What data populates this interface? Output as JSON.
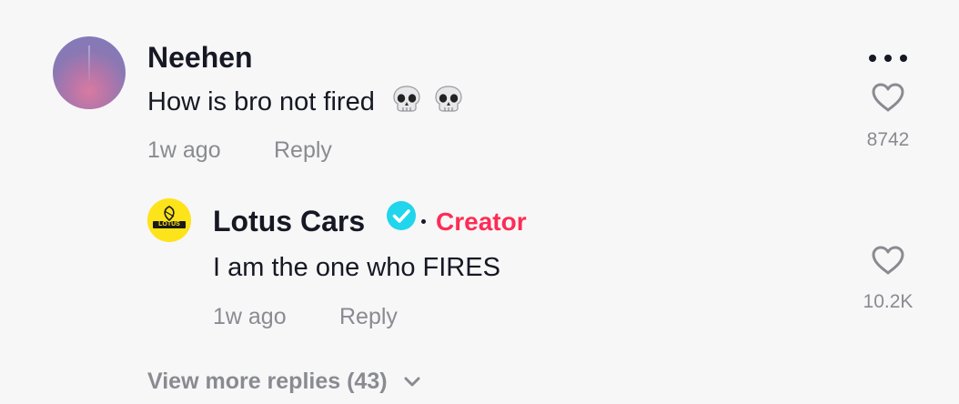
{
  "comment": {
    "username": "Neehen",
    "text": "How is bro not fired",
    "emoji": "skull-icon x2",
    "time": "1w ago",
    "reply_label": "Reply",
    "likes": "8742"
  },
  "reply": {
    "username": "Lotus Cars",
    "badge_separator": "·",
    "badge_label": "Creator",
    "avatar_text": "LOTUS",
    "text": "I am the one who FIRES",
    "time": "1w ago",
    "reply_label": "Reply",
    "likes": "10.2K"
  },
  "view_more": {
    "label": "View more replies (43)"
  },
  "colors": {
    "background": "#f7f7f8",
    "text": "#161823",
    "secondary": "#8a8b91",
    "creator": "#fe2c55",
    "verified": "#20d5ec",
    "lotus_yellow": "#fde31a"
  },
  "icons": [
    "more-icon",
    "heart-icon",
    "verified-badge-icon",
    "chevron-down-icon",
    "skull-icon"
  ]
}
